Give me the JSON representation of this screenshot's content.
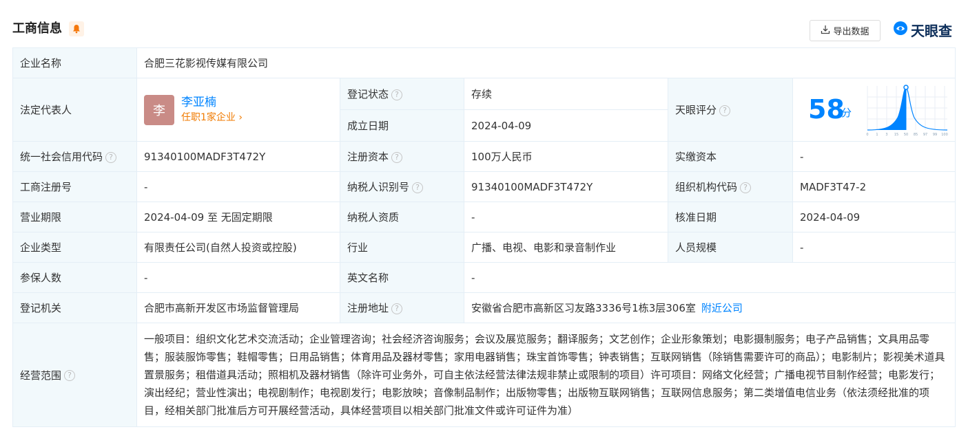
{
  "header": {
    "title": "工商信息",
    "export_label": "导出数据",
    "logo_text": "天眼查"
  },
  "company": {
    "name_label": "企业名称",
    "name": "合肥三花影视传媒有限公司",
    "legal_rep_label": "法定代表人",
    "legal_rep_avatar": "李",
    "legal_rep_name": "李亚楠",
    "legal_rep_jobs": "任职1家企业",
    "reg_status_label": "登记状态",
    "reg_status": "存续",
    "found_date_label": "成立日期",
    "found_date": "2024-04-09",
    "score_label": "天眼评分",
    "score": "58",
    "score_unit": "分",
    "score_axis": [
      "0",
      "1",
      "3",
      "15",
      "50",
      "85",
      "97",
      "99",
      "100"
    ],
    "credit_code_label": "统一社会信用代码",
    "credit_code": "91340100MADF3T472Y",
    "reg_capital_label": "注册资本",
    "reg_capital": "100万人民币",
    "paid_capital_label": "实缴资本",
    "paid_capital": "-",
    "reg_no_label": "工商注册号",
    "reg_no": "-",
    "taxpayer_id_label": "纳税人识别号",
    "taxpayer_id": "91340100MADF3T472Y",
    "org_code_label": "组织机构代码",
    "org_code": "MADF3T47-2",
    "term_label": "营业期限",
    "term": "2024-04-09 至 无固定期限",
    "taxpayer_qual_label": "纳税人资质",
    "taxpayer_qual": "-",
    "approve_date_label": "核准日期",
    "approve_date": "2024-04-09",
    "type_label": "企业类型",
    "type": "有限责任公司(自然人投资或控股)",
    "industry_label": "行业",
    "industry": "广播、电视、电影和录音制作业",
    "staff_label": "人员规模",
    "staff": "-",
    "insured_label": "参保人数",
    "insured": "-",
    "english_name_label": "英文名称",
    "english_name": "-",
    "authority_label": "登记机关",
    "authority": "合肥市高新开发区市场监督管理局",
    "address_label": "注册地址",
    "address": "安徽省合肥市高新区习友路3336号1栋3层306室",
    "nearby_label": "附近公司",
    "scope_label": "经营范围",
    "scope": "一般项目：组织文化艺术交流活动；企业管理咨询；社会经济咨询服务；会议及展览服务；翻译服务；文艺创作；企业形象策划；电影摄制服务；电子产品销售；文具用品零售；服装服饰零售；鞋帽零售；日用品销售；体育用品及器材零售；家用电器销售；珠宝首饰零售；钟表销售；互联网销售（除销售需要许可的商品）；电影制片；影视美术道具置景服务；租借道具活动；照相机及器材销售（除许可业务外，可自主依法经营法律法规非禁止或限制的项目）许可项目：网络文化经营；广播电视节目制作经营；电影发行；演出经纪；营业性演出；电视剧制作；电视剧发行；电影放映；音像制品制作；出版物零售；出版物互联网销售；互联网信息服务；第二类增值电信业务（依法须经批准的项目，经相关部门批准后方可开展经营活动，具体经营项目以相关部门批准文件或许可证件为准）"
  },
  "colors": {
    "label_bg": "#f2f9fc",
    "border": "#e4eef6",
    "link": "#0084ff",
    "status": "#3dab66",
    "orange": "#f07a00"
  }
}
